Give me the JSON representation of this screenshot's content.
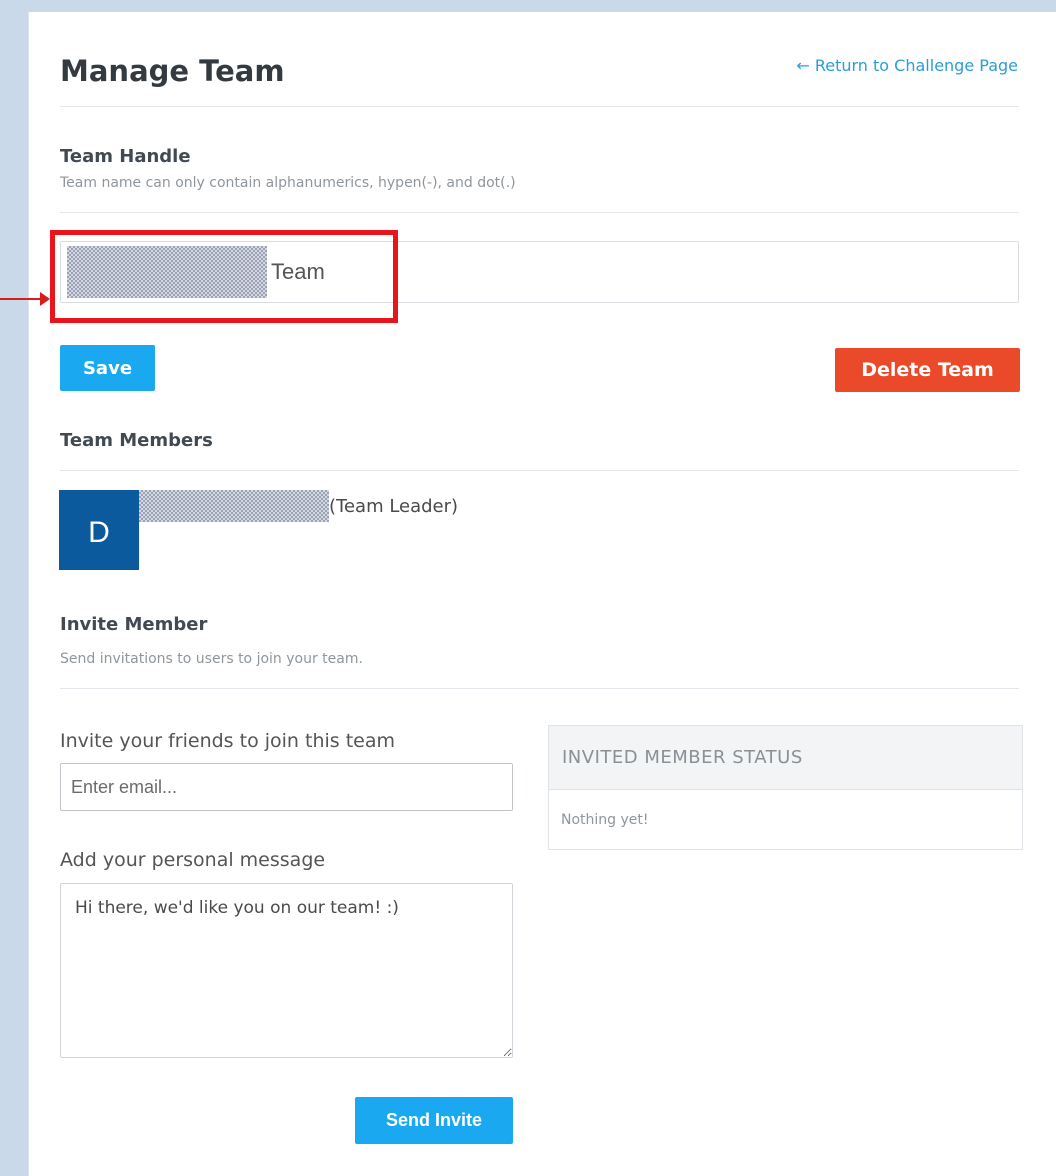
{
  "header": {
    "title": "Manage Team",
    "return_link": "← Return to Challenge Page"
  },
  "team_handle": {
    "title": "Team Handle",
    "help": "Team name can only contain alphanumerics, hypen(-), and dot(.)",
    "value_suffix": "Team"
  },
  "actions": {
    "save_label": "Save",
    "delete_label": "Delete Team"
  },
  "members": {
    "title": "Team Members",
    "items": [
      {
        "avatar_initial": "D",
        "role": "(Team Leader)"
      }
    ]
  },
  "invite": {
    "title": "Invite Member",
    "help": "Send invitations to users to join your team.",
    "friends_label": "Invite your friends to join this team",
    "email_placeholder": "Enter email...",
    "message_label": "Add your personal message",
    "message_value": "Hi there, we'd like you on our team! :)",
    "send_label": "Send Invite"
  },
  "status": {
    "header": "INVITED MEMBER STATUS",
    "empty_text": "Nothing yet!"
  },
  "colors": {
    "accent": "#1aa9f0",
    "danger": "#ea4a2a",
    "avatar": "#0c5a9e",
    "highlight": "#e8161c"
  }
}
